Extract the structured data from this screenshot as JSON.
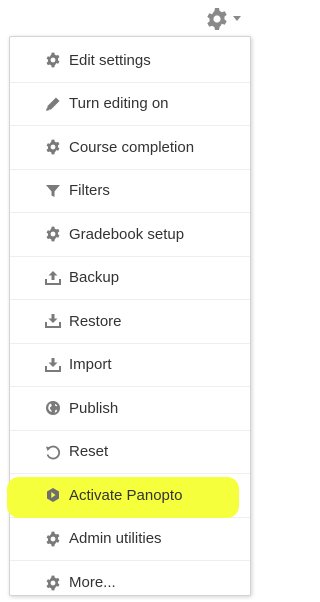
{
  "trigger": {
    "icon": "gear-icon",
    "caret": "caret-down-icon"
  },
  "colors": {
    "icon": "#7a7a7a",
    "text": "#333333",
    "highlight": "#f6ff3b",
    "border": "#d4d4d4"
  },
  "menu": {
    "items": [
      {
        "label": "Edit settings",
        "icon": "gear-icon"
      },
      {
        "label": "Turn editing on",
        "icon": "pencil-icon"
      },
      {
        "label": "Course completion",
        "icon": "gear-icon"
      },
      {
        "label": "Filters",
        "icon": "filter-icon"
      },
      {
        "label": "Gradebook setup",
        "icon": "gear-icon"
      },
      {
        "label": "Backup",
        "icon": "upload-icon"
      },
      {
        "label": "Restore",
        "icon": "download-icon"
      },
      {
        "label": "Import",
        "icon": "download-icon"
      },
      {
        "label": "Publish",
        "icon": "globe-icon"
      },
      {
        "label": "Reset",
        "icon": "reset-icon"
      },
      {
        "label": "Activate Panopto",
        "icon": "panopto-icon",
        "highlighted": true
      },
      {
        "label": "Admin utilities",
        "icon": "gear-icon"
      },
      {
        "label": "More...",
        "icon": "gear-icon"
      }
    ]
  }
}
